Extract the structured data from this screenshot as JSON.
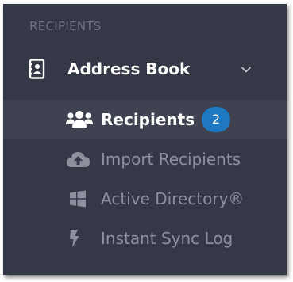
{
  "sidebar": {
    "section_header": "RECIPIENTS",
    "group": {
      "label": "Address Book",
      "icon": "address-book-icon",
      "expanded": true
    },
    "items": [
      {
        "label": "Recipients",
        "icon": "users-icon",
        "active": true,
        "badge": "2"
      },
      {
        "label": "Import Recipients",
        "icon": "cloud-upload-icon",
        "active": false
      },
      {
        "label": "Active Directory®",
        "icon": "windows-icon",
        "active": false
      },
      {
        "label": "Instant Sync Log",
        "icon": "lightning-bolt-icon",
        "active": false
      }
    ]
  },
  "colors": {
    "sidebar_bg": "#353846",
    "active_row_bg": "#3f4250",
    "badge_bg": "#1e78c2",
    "muted_text": "#8d909c",
    "header_text": "#6f7383"
  }
}
